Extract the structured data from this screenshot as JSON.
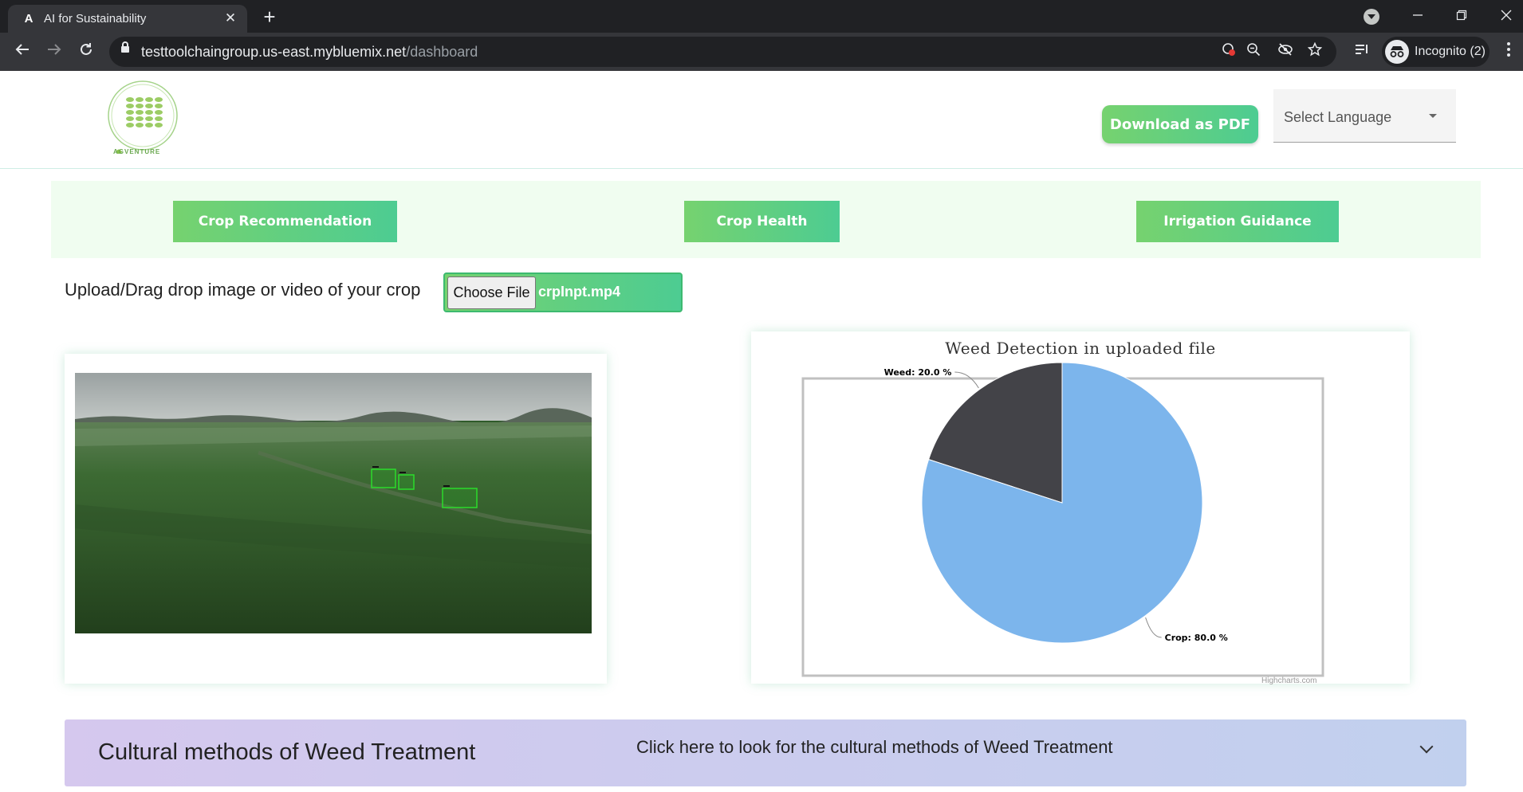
{
  "browser": {
    "tab_title": "AI for Sustainability",
    "tab_favicon": "A",
    "tab_close": "✕",
    "new_tab": "+",
    "url_host": "testtoolchaingroup.us-east.mybluemix.net",
    "url_path": "/dashboard",
    "profile_label": "Incognito (2)",
    "icons": [
      "back-arrow-icon",
      "forward-arrow-icon",
      "reload-icon",
      "lock-icon",
      "blocked-cookie-icon",
      "zoom-icon",
      "tracking-blocked-icon",
      "star-icon",
      "reading-list-icon",
      "incognito-icon",
      "more-vert-icon"
    ]
  },
  "header": {
    "logo_caption": "AGVENTURE",
    "download_pdf_label": "Download as PDF",
    "language_select": "Select Language"
  },
  "nav": {
    "items": [
      {
        "label": "Crop Recommendation"
      },
      {
        "label": "Crop Health"
      },
      {
        "label": "Irrigation Guidance"
      }
    ]
  },
  "upload": {
    "label": "Upload/Drag drop image or video of your crop",
    "button_label": "Choose File",
    "file_name": "crpInpt.mp4"
  },
  "chart_data": {
    "type": "pie",
    "title": "Weed Detection in uploaded file",
    "slices": [
      {
        "name": "Weed",
        "value": 20.0,
        "label": "Weed: 20.0 %",
        "color": "#434348"
      },
      {
        "name": "Crop",
        "value": 80.0,
        "label": "Crop: 80.0 %",
        "color": "#7cb5ec"
      }
    ],
    "credits": "Highcharts.com"
  },
  "accordion": {
    "title": "Cultural methods of Weed Treatment",
    "link_text": "Click here to look for the cultural methods of Weed Treatment"
  },
  "colors": {
    "accent_start": "#76d26f",
    "accent_end": "#4dcc92",
    "nav_strip_bg": "#f0fdf0",
    "accordion_start": "#d5c8ee",
    "accordion_end": "#c1d0ee"
  }
}
